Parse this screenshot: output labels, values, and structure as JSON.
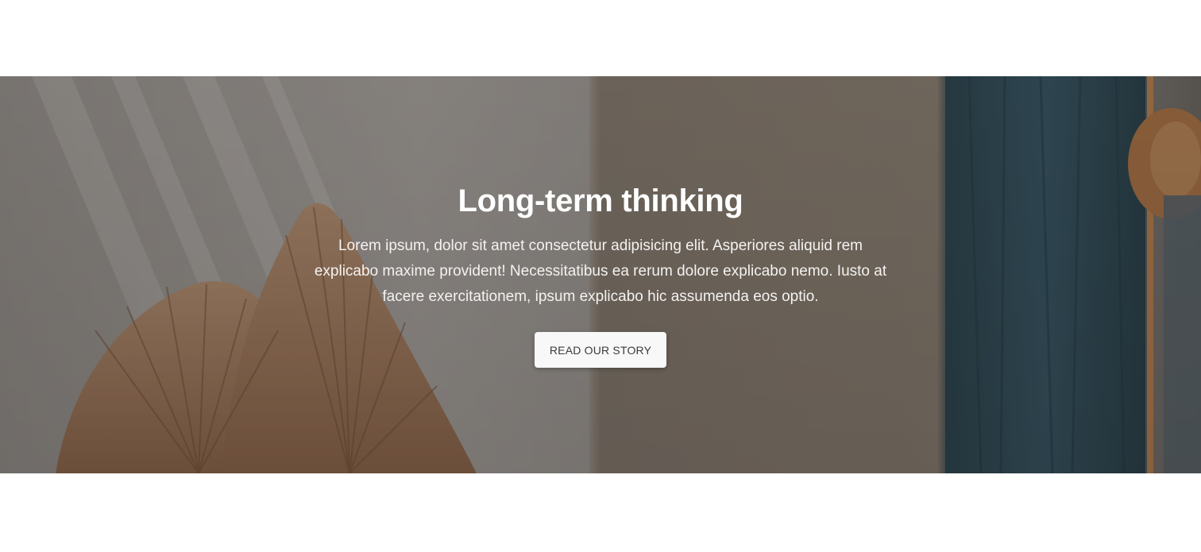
{
  "hero": {
    "title": "Long-term thinking",
    "text": "Lorem ipsum, dolor sit amet consectetur adipisicing elit. Asperiores aliquid rem explicabo maxime provident! Necessitatibus ea rerum dolore explicabo nemo. Iusto at facere exercitationem, ipsum explicabo hic assumenda eos optio.",
    "button_label": "READ OUR STORY"
  },
  "colors": {
    "page_background": "#ffffff",
    "title_text": "#ffffff",
    "button_background": "#f8f8f8",
    "button_text": "#3a3a3a"
  }
}
